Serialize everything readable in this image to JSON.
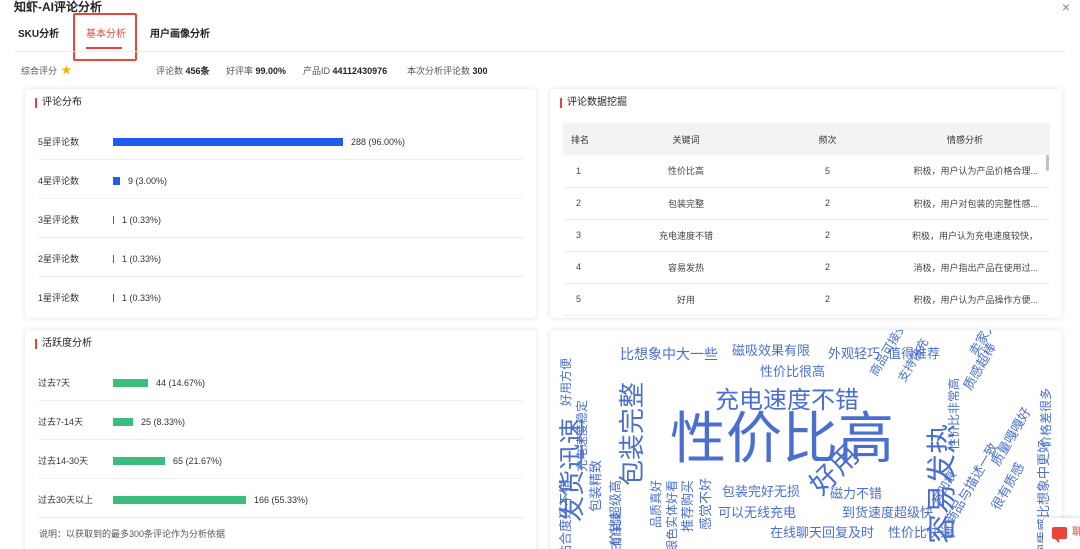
{
  "app": {
    "title": "知虾-AI评论分析"
  },
  "tabs": [
    {
      "label": "SKU分析"
    },
    {
      "label": "基本分析"
    },
    {
      "label": "用户画像分析"
    }
  ],
  "summary": {
    "rating_label": "综合评分",
    "rating_stars": 5,
    "review_count_label": "评论数",
    "review_count": "456条",
    "positive_rate_label": "好评率",
    "positive_rate": "99.00%",
    "product_id_label": "产品ID",
    "product_id": "44112430976",
    "analyzed_count_label": "本次分析评论数",
    "analyzed_count": "300"
  },
  "distribution": {
    "title": "评论分布",
    "color": "#1e5cf0",
    "rows": [
      {
        "label": "5星评论数",
        "value_text": "288 (96.00%)",
        "fraction": 0.96
      },
      {
        "label": "4星评论数",
        "value_text": "9 (3.00%)",
        "fraction": 0.03
      },
      {
        "label": "3星评论数",
        "value_text": "1 (0.33%)",
        "fraction": 0.0033
      },
      {
        "label": "2星评论数",
        "value_text": "1 (0.33%)",
        "fraction": 0.0033
      },
      {
        "label": "1星评论数",
        "value_text": "1 (0.33%)",
        "fraction": 0.0033
      }
    ]
  },
  "mining": {
    "title": "评论数据挖掘",
    "columns": [
      "排名",
      "关键词",
      "频次",
      "情感分析"
    ],
    "rows": [
      [
        "1",
        "性价比高",
        "5",
        "积极，用户认为产品价格合理..."
      ],
      [
        "2",
        "包装完整",
        "2",
        "积极，用户对包装的完整性感..."
      ],
      [
        "3",
        "充电速度不错",
        "2",
        "积极，用户认为充电速度较快，"
      ],
      [
        "4",
        "容易发热",
        "2",
        "消极，用户指出产品在使用过..."
      ],
      [
        "5",
        "好用",
        "2",
        "积极，用户认为产品操作方便..."
      ]
    ]
  },
  "activity": {
    "title": "活跃度分析",
    "color": "#3dbd7d",
    "rows": [
      {
        "label": "过去7天",
        "value_text": "44 (14.67%)",
        "fraction": 0.1467
      },
      {
        "label": "过去7-14天",
        "value_text": "25 (8.33%)",
        "fraction": 0.0833
      },
      {
        "label": "过去14-30天",
        "value_text": "65 (21.67%)",
        "fraction": 0.2167
      },
      {
        "label": "过去30天以上",
        "value_text": "166 (55.33%)",
        "fraction": 0.5533
      }
    ],
    "note": "说明：以获取到的最多300条评论作为分析依据"
  },
  "wordcloud": {
    "color": "#4a6fd1",
    "words": [
      {
        "text": "性价比高"
      },
      {
        "text": "充电速度不错"
      },
      {
        "text": "发货迅速"
      },
      {
        "text": "包装完整"
      },
      {
        "text": "容易发热"
      },
      {
        "text": "好用"
      },
      {
        "text": "比想象中大一些"
      },
      {
        "text": "磁吸效果有限"
      },
      {
        "text": "外观轻巧"
      },
      {
        "text": "值得推荐"
      },
      {
        "text": "性价比很高"
      },
      {
        "text": "好用方便"
      },
      {
        "text": "充电速度稳定"
      },
      {
        "text": "包装精致"
      },
      {
        "text": "性价比超级高"
      },
      {
        "text": "包装完好无损"
      },
      {
        "text": "磁力不错"
      },
      {
        "text": "可以无线充电"
      },
      {
        "text": "到货速度超级快"
      },
      {
        "text": "在线聊天回复及时"
      },
      {
        "text": "性价比快速"
      },
      {
        "text": "品质有保障"
      },
      {
        "text": "贴合度还不错"
      },
      {
        "text": "推荐购买"
      },
      {
        "text": "银色实体好看"
      },
      {
        "text": "感觉不好"
      },
      {
        "text": "品质真好"
      },
      {
        "text": "卖家人很好"
      },
      {
        "text": "质感超棒"
      },
      {
        "text": "价格差很多"
      },
      {
        "text": "性价比非常高"
      },
      {
        "text": "支持快充"
      },
      {
        "text": "商品与描述一致"
      },
      {
        "text": "质量嘎嘎好"
      },
      {
        "text": "有凹痕"
      },
      {
        "text": "很有质感"
      },
      {
        "text": "外观质感比想象中更好"
      },
      {
        "text": "商品可接受"
      }
    ]
  },
  "chat": {
    "label": "聊"
  }
}
